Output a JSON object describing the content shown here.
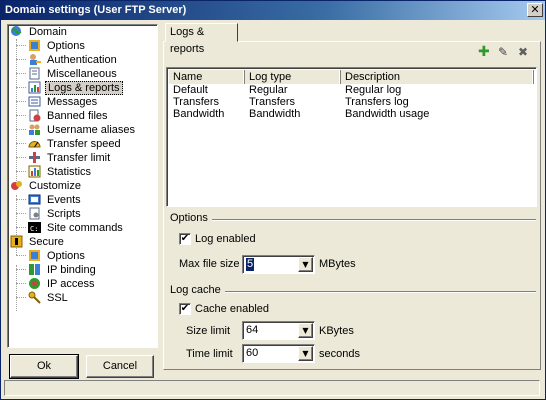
{
  "window": {
    "title": "Domain settings (User FTP Server)",
    "close_glyph": "✕"
  },
  "tree": {
    "domain": "Domain",
    "options": "Options",
    "authentication": "Authentication",
    "miscellaneous": "Miscellaneous",
    "logs_reports": "Logs & reports",
    "messages": "Messages",
    "banned_files": "Banned files",
    "username_aliases": "Username aliases",
    "transfer_speed": "Transfer speed",
    "transfer_limit": "Transfer limit",
    "statistics": "Statistics",
    "customize": "Customize",
    "events": "Events",
    "scripts": "Scripts",
    "site_commands": "Site commands",
    "secure": "Secure",
    "secure_options": "Options",
    "ip_binding": "IP binding",
    "ip_access": "IP access",
    "ssl": "SSL"
  },
  "buttons": {
    "ok": "Ok",
    "cancel": "Cancel"
  },
  "tab": {
    "label": "Logs & reports"
  },
  "toolbar": {
    "add_glyph": "✚",
    "edit_glyph": "✎",
    "delete_glyph": "✖"
  },
  "logs_table": {
    "columns": [
      "Name",
      "Log type",
      "Description"
    ],
    "rows": [
      [
        "Default",
        "Regular",
        "Regular log"
      ],
      [
        "Transfers",
        "Transfers",
        "Transfers log"
      ],
      [
        "Bandwidth",
        "Bandwidth",
        "Bandwidth usage"
      ]
    ]
  },
  "options": {
    "group_label": "Options",
    "log_enabled_label": "Log enabled",
    "log_enabled_checked": true,
    "check_glyph": "✔",
    "max_file_size_label": "Max file size",
    "max_file_size_value": "5",
    "max_file_size_unit": "MBytes"
  },
  "log_cache": {
    "group_label": "Log cache",
    "cache_enabled_label": "Cache enabled",
    "cache_enabled_checked": true,
    "size_limit_label": "Size limit",
    "size_limit_value": "64",
    "size_limit_unit": "KBytes",
    "time_limit_label": "Time limit",
    "time_limit_value": "60",
    "time_limit_unit": "seconds"
  },
  "dropdown_glyph": "▼",
  "colors": {
    "titlebar_start": "#0a246a",
    "titlebar_end": "#a6caf0",
    "dialog_bg": "#ece9d8",
    "add_green": "#2e9a2e"
  }
}
